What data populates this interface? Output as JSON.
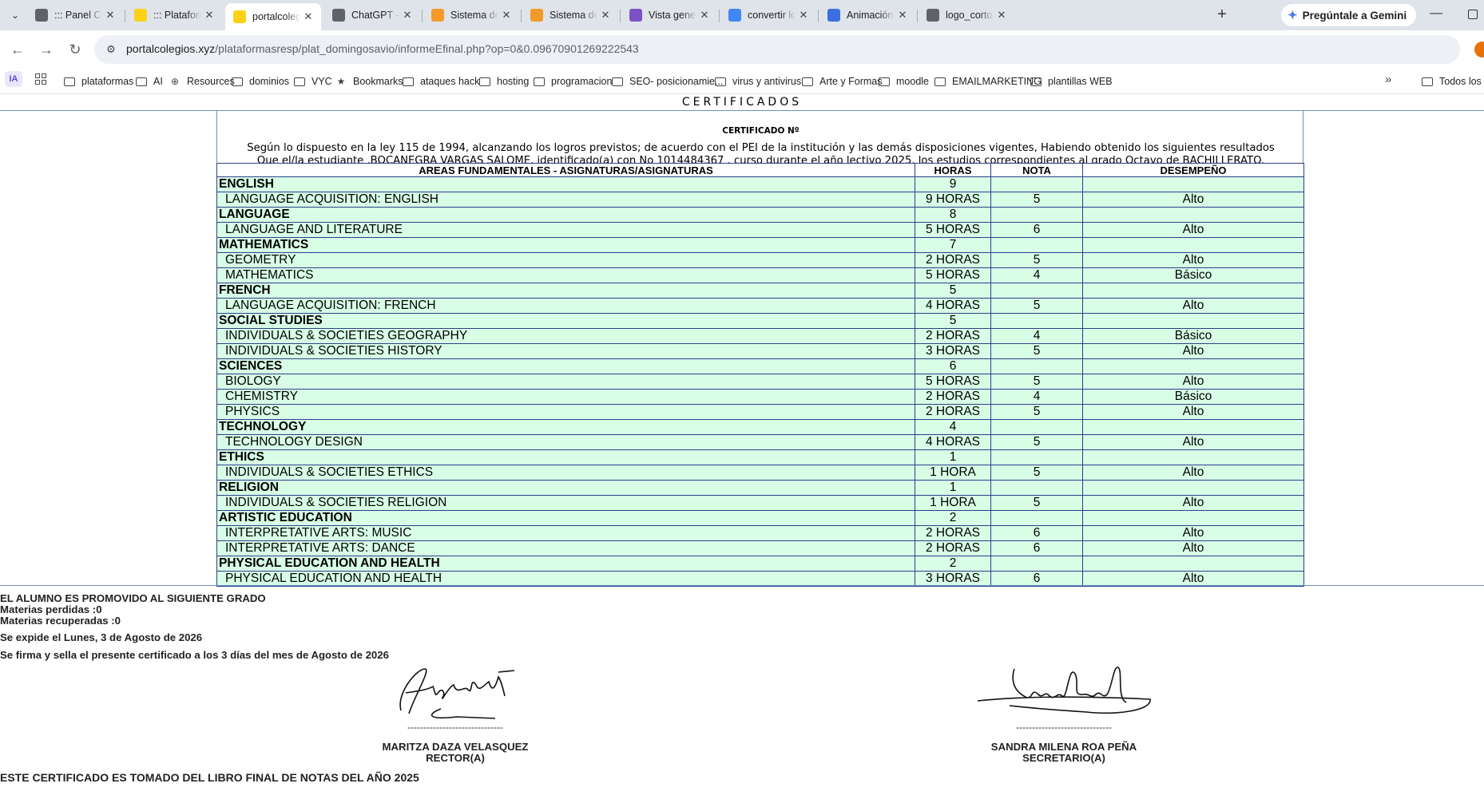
{
  "browser": {
    "tabs": [
      {
        "title": "::: Panel Colegios",
        "favicon_color": "#5f6368",
        "active": false
      },
      {
        "title": "::: Plataforma de...",
        "favicon_color": "#fcd116",
        "active": false
      },
      {
        "title": "portalcolegios",
        "favicon_color": "#fcd116",
        "active": true
      },
      {
        "title": "ChatGPT - disc...",
        "favicon_color": "#5f6368",
        "active": false
      },
      {
        "title": "Sistema de No...",
        "favicon_color": "#f29b2b",
        "active": false
      },
      {
        "title": "Sistema de pa...",
        "favicon_color": "#f29b2b",
        "active": false
      },
      {
        "title": "Vista general |...",
        "favicon_color": "#7b52c6",
        "active": false
      },
      {
        "title": "convertir logo...",
        "favicon_color": "#4285f4",
        "active": false
      },
      {
        "title": "Animación de...",
        "favicon_color": "#3b6fe0",
        "active": false
      },
      {
        "title": "logo_corto_tra...",
        "favicon_color": "#5f6368",
        "active": false
      }
    ],
    "gemini_label": "Pregúntale a Gemini",
    "url_host": "portalcolegios.xyz",
    "url_path": "/plataformasresp/plat_domingosavio/informeEfinal.php?op=0&0.09670901269222543",
    "ia_badge": "IA",
    "bookmarks": [
      {
        "label": "plataformas",
        "icon": "folder-icon"
      },
      {
        "label": "AI",
        "icon": "folder-icon"
      },
      {
        "label": "Resources",
        "icon": "globe-icon"
      },
      {
        "label": "dominios",
        "icon": "folder-icon"
      },
      {
        "label": "VYC",
        "icon": "folder-icon"
      },
      {
        "label": "Bookmarks",
        "icon": "star-icon"
      },
      {
        "label": "ataques hack",
        "icon": "folder-icon"
      },
      {
        "label": "hosting",
        "icon": "folder-icon"
      },
      {
        "label": "programacion",
        "icon": "folder-icon"
      },
      {
        "label": "SEO- posicionamie...",
        "icon": "folder-icon"
      },
      {
        "label": "virus y antivirus",
        "icon": "folder-icon"
      },
      {
        "label": "Arte y Formas",
        "icon": "folder-icon"
      },
      {
        "label": "moodle",
        "icon": "folder-icon"
      },
      {
        "label": "EMAILMARKETING",
        "icon": "folder-icon"
      },
      {
        "label": "plantillas WEB",
        "icon": "folder-icon"
      }
    ],
    "all_bookmarks": "Todos los"
  },
  "page": {
    "title": "CERTIFICADOS",
    "cert_number_label": "CERTIFICADO Nº",
    "paragraph1": "Según lo dispuesto en la ley 115 de 1994, alcanzando los logros previstos; de acuerdo con el PEI de la institución y las demás disposiciones vigentes, Habiendo obtenido los siguientes resultados",
    "paragraph2": "Que el/la estudiante ,BOCANEGRA VARGAS SALOME, identificado(a) con No 1014484367 , curso durante el año lectivo 2025, los estudios correspondientes al grado Octavo de BACHILLERATO.",
    "table": {
      "headers": [
        "AREAS FUNDAMENTALES - ASIGNATURAS/ASIGNATURAS",
        "HORAS",
        "NOTA",
        "DESEMPEÑO"
      ],
      "rows": [
        {
          "type": "area",
          "name": "ENGLISH",
          "horas": "9",
          "nota": "",
          "desempeno": ""
        },
        {
          "type": "subj",
          "name": "LANGUAGE ACQUISITION: ENGLISH",
          "horas": "9 HORAS",
          "nota": "5",
          "desempeno": "Alto"
        },
        {
          "type": "area",
          "name": "LANGUAGE",
          "horas": "8",
          "nota": "",
          "desempeno": ""
        },
        {
          "type": "subj",
          "name": "LANGUAGE AND LITERATURE",
          "horas": "5 HORAS",
          "nota": "6",
          "desempeno": "Alto"
        },
        {
          "type": "area",
          "name": "MATHEMATICS",
          "horas": "7",
          "nota": "",
          "desempeno": ""
        },
        {
          "type": "subj",
          "name": "GEOMETRY",
          "horas": "2 HORAS",
          "nota": "5",
          "desempeno": "Alto"
        },
        {
          "type": "subj",
          "name": "MATHEMATICS",
          "horas": "5 HORAS",
          "nota": "4",
          "desempeno": "Básico"
        },
        {
          "type": "area",
          "name": "FRENCH",
          "horas": "5",
          "nota": "",
          "desempeno": ""
        },
        {
          "type": "subj",
          "name": "LANGUAGE ACQUISITION: FRENCH",
          "horas": "4 HORAS",
          "nota": "5",
          "desempeno": "Alto"
        },
        {
          "type": "area",
          "name": "SOCIAL STUDIES",
          "horas": "5",
          "nota": "",
          "desempeno": ""
        },
        {
          "type": "subj",
          "name": "INDIVIDUALS & SOCIETIES GEOGRAPHY",
          "horas": "2 HORAS",
          "nota": "4",
          "desempeno": "Básico"
        },
        {
          "type": "subj",
          "name": "INDIVIDUALS & SOCIETIES HISTORY",
          "horas": "3 HORAS",
          "nota": "5",
          "desempeno": "Alto"
        },
        {
          "type": "area",
          "name": "SCIENCES",
          "horas": "6",
          "nota": "",
          "desempeno": ""
        },
        {
          "type": "subj",
          "name": "BIOLOGY",
          "horas": "5 HORAS",
          "nota": "5",
          "desempeno": "Alto"
        },
        {
          "type": "subj",
          "name": "CHEMISTRY",
          "horas": "2 HORAS",
          "nota": "4",
          "desempeno": "Básico"
        },
        {
          "type": "subj",
          "name": "PHYSICS",
          "horas": "2 HORAS",
          "nota": "5",
          "desempeno": "Alto"
        },
        {
          "type": "area",
          "name": "TECHNOLOGY",
          "horas": "4",
          "nota": "",
          "desempeno": ""
        },
        {
          "type": "subj",
          "name": "TECHNOLOGY DESIGN",
          "horas": "4 HORAS",
          "nota": "5",
          "desempeno": "Alto"
        },
        {
          "type": "area",
          "name": "ETHICS",
          "horas": "1",
          "nota": "",
          "desempeno": ""
        },
        {
          "type": "subj",
          "name": "INDIVIDUALS & SOCIETIES ETHICS",
          "horas": "1 HORA",
          "nota": "5",
          "desempeno": "Alto"
        },
        {
          "type": "area",
          "name": "RELIGION",
          "horas": "1",
          "nota": "",
          "desempeno": ""
        },
        {
          "type": "subj",
          "name": "INDIVIDUALS & SOCIETIES RELIGION",
          "horas": "1 HORA",
          "nota": "5",
          "desempeno": "Alto"
        },
        {
          "type": "area",
          "name": "ARTISTIC EDUCATION",
          "horas": "2",
          "nota": "",
          "desempeno": ""
        },
        {
          "type": "subj",
          "name": " INTERPRETATIVE ARTS: MUSIC",
          "horas": "2 HORAS",
          "nota": "6",
          "desempeno": "Alto"
        },
        {
          "type": "subj",
          "name": "INTERPRETATIVE ARTS: DANCE",
          "horas": "2 HORAS",
          "nota": "6",
          "desempeno": "Alto"
        },
        {
          "type": "area",
          "name": "PHYSICAL EDUCATION AND HEALTH",
          "horas": "2",
          "nota": "",
          "desempeno": ""
        },
        {
          "type": "subj",
          "name": "PHYSICAL EDUCATION AND HEALTH",
          "horas": "3 HORAS",
          "nota": "6",
          "desempeno": "Alto"
        }
      ]
    },
    "promoted": "EL ALUMNO ES PROMOVIDO AL SIGUIENTE GRADO",
    "lost": "Materias perdidas :0",
    "recovered": "Materias recuperadas :0",
    "issued": "Se expide el Lunes, 3 de Agosto de 2026",
    "signed": "Se firma y sella el presente certificado a los 3 días del mes de Agosto de 2026",
    "sig_line": "------------------------------",
    "rector_name": "MARITZA DAZA VELASQUEZ",
    "rector_role": "RECTOR(A)",
    "secretary_name": "SANDRA MILENA ROA PEÑA",
    "secretary_role": "SECRETARIO(A)",
    "footer": "ESTE CERTIFICADO ES TOMADO DEL LIBRO FINAL DE NOTAS DEL AÑO 2025"
  }
}
